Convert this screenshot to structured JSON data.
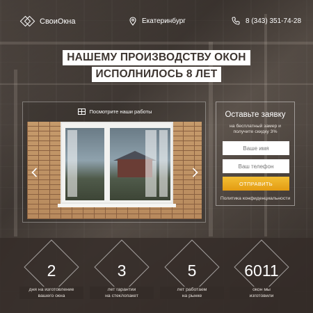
{
  "header": {
    "logo_text": "СвоиОкна",
    "logo_icon": "diamonds-logo-icon",
    "city": "Екатеринбург",
    "city_icon": "location-pin-icon",
    "phone": "8 (343) 351-74-28",
    "phone_icon": "phone-icon"
  },
  "hero": {
    "line1": "НАШЕМУ ПРОИЗВОДСТВУ ОКОН",
    "line2": "ИСПОЛНИЛОСЬ 8 ЛЕТ"
  },
  "gallery": {
    "title": "Посмотрите наши работы",
    "title_icon": "grid-icon",
    "prev_icon": "chevron-left-icon",
    "next_icon": "chevron-right-icon"
  },
  "form": {
    "title": "Оставьте заявку",
    "subtitle_line1": "на бесплатный замер и",
    "subtitle_line2": "получите скидку 3%",
    "name_placeholder": "Ваше имя",
    "phone_placeholder": "Ваш телефон",
    "submit_label": "ОТПРАВИТЬ",
    "policy_link": "Политика конфиденциальности",
    "accent_color": "#f0b020"
  },
  "stats": [
    {
      "value": "2",
      "caption_line1": "дня на изготовление",
      "caption_line2": "вашего окна"
    },
    {
      "value": "3",
      "caption_line1": "лет гарантии",
      "caption_line2": "на стеклопакет"
    },
    {
      "value": "5",
      "caption_line1": "лет работаем",
      "caption_line2": "на рынке"
    },
    {
      "value": "6011",
      "caption_line1": "окон мы",
      "caption_line2": "изготовили"
    }
  ]
}
